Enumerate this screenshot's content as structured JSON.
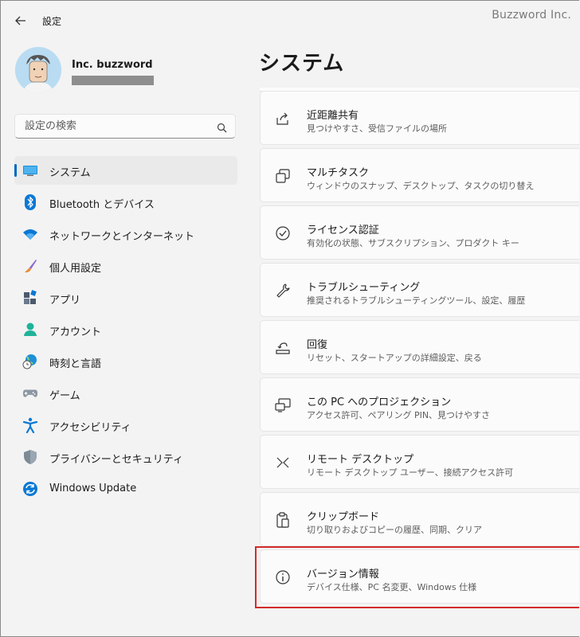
{
  "app": {
    "title": "設定"
  },
  "watermark": "Buzzword Inc.",
  "user": {
    "name": "Inc. buzzword"
  },
  "search": {
    "placeholder": "設定の検索"
  },
  "sidebar": {
    "items": [
      {
        "label": "システム",
        "icon": "system-icon",
        "active": true
      },
      {
        "label": "Bluetooth とデバイス",
        "icon": "bluetooth-icon"
      },
      {
        "label": "ネットワークとインターネット",
        "icon": "wifi-icon"
      },
      {
        "label": "個人用設定",
        "icon": "brush-icon"
      },
      {
        "label": "アプリ",
        "icon": "apps-icon"
      },
      {
        "label": "アカウント",
        "icon": "account-icon"
      },
      {
        "label": "時刻と言語",
        "icon": "globe-clock-icon"
      },
      {
        "label": "ゲーム",
        "icon": "gamepad-icon"
      },
      {
        "label": "アクセシビリティ",
        "icon": "accessibility-icon"
      },
      {
        "label": "プライバシーとセキュリティ",
        "icon": "shield-icon"
      },
      {
        "label": "Windows Update",
        "icon": "update-icon"
      }
    ]
  },
  "main": {
    "title": "システム",
    "cards": [
      {
        "title": "近距離共有",
        "subtitle": "見つけやすさ、受信ファイルの場所",
        "icon": "share-icon"
      },
      {
        "title": "マルチタスク",
        "subtitle": "ウィンドウのスナップ、デスクトップ、タスクの切り替え",
        "icon": "multitask-icon"
      },
      {
        "title": "ライセンス認証",
        "subtitle": "有効化の状態、サブスクリプション、プロダクト キー",
        "icon": "check-circle-icon"
      },
      {
        "title": "トラブルシューティング",
        "subtitle": "推奨されるトラブルシューティングツール、設定、履歴",
        "icon": "wrench-icon"
      },
      {
        "title": "回復",
        "subtitle": "リセット、スタートアップの詳細設定、戻る",
        "icon": "recovery-icon"
      },
      {
        "title": "この PC へのプロジェクション",
        "subtitle": "アクセス許可、ペアリング PIN、見つけやすさ",
        "icon": "projection-icon"
      },
      {
        "title": "リモート デスクトップ",
        "subtitle": "リモート デスクトップ ユーザー、接続アクセス許可",
        "icon": "remote-desktop-icon"
      },
      {
        "title": "クリップボード",
        "subtitle": "切り取りおよびコピーの履歴、同期、クリア",
        "icon": "clipboard-icon"
      },
      {
        "title": "バージョン情報",
        "subtitle": "デバイス仕様、PC 名変更、Windows 仕様",
        "icon": "info-icon"
      }
    ]
  },
  "colors": {
    "accent": "#0067c0",
    "highlight": "#d42a2a"
  }
}
